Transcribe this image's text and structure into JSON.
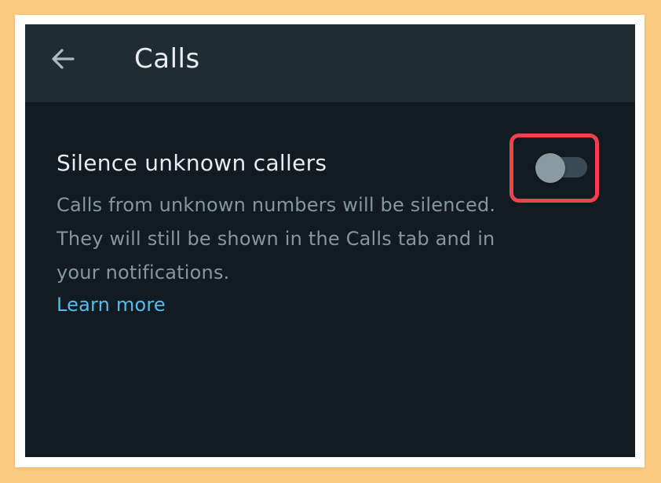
{
  "app_bar": {
    "back_icon": "arrow-left-icon",
    "title": "Calls"
  },
  "setting": {
    "title": "Silence unknown callers",
    "description": "Calls from unknown numbers will be silenced. They will still be shown in the Calls tab and in your notifications.",
    "learn_more": "Learn more",
    "toggle_state": "off",
    "highlight_color": "#f0424a"
  },
  "colors": {
    "background": "#111b21",
    "app_bar": "#1f2c34",
    "primary_text": "#e9edef",
    "secondary_text": "#8696a0",
    "link": "#53bdeb",
    "outer_border": "#f9c980"
  }
}
